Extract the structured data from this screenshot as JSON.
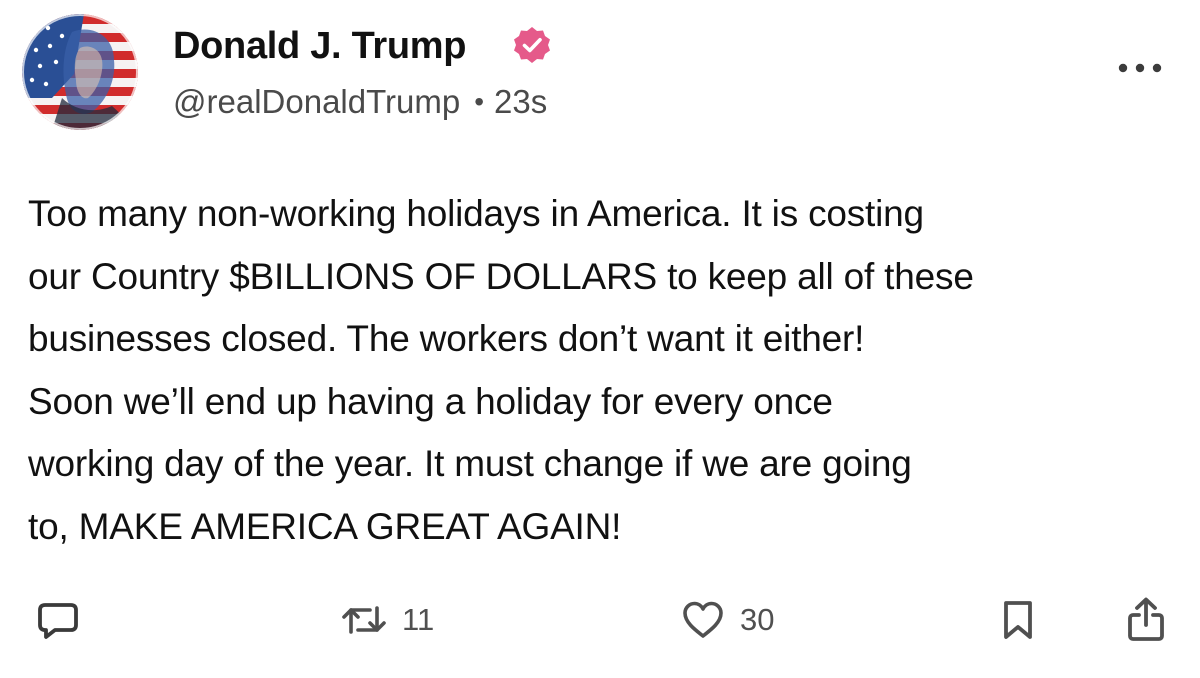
{
  "post": {
    "author_name": "Donald J. Trump",
    "handle": "@realDonaldTrump",
    "separator": "•",
    "timestamp": "23s",
    "verified_color": "#e55a8a",
    "avatar_icon": "profile-photo-flag-portrait",
    "more_icon": "more-horizontal-icon",
    "body": "Too many non-working holidays in America. It is costing\nour Country $BILLIONS OF DOLLARS to keep all of these\nbusinesses closed. The workers don’t want it either!\nSoon we’ll end up having a holiday for every once\nworking day of the year. It must change if we are going\nto, MAKE AMERICA GREAT AGAIN!"
  },
  "actions": {
    "reply_icon": "comment-icon",
    "repost_icon": "repost-icon",
    "repost_count": "11",
    "like_icon": "heart-icon",
    "like_count": "30",
    "bookmark_icon": "bookmark-icon",
    "share_icon": "share-icon"
  }
}
